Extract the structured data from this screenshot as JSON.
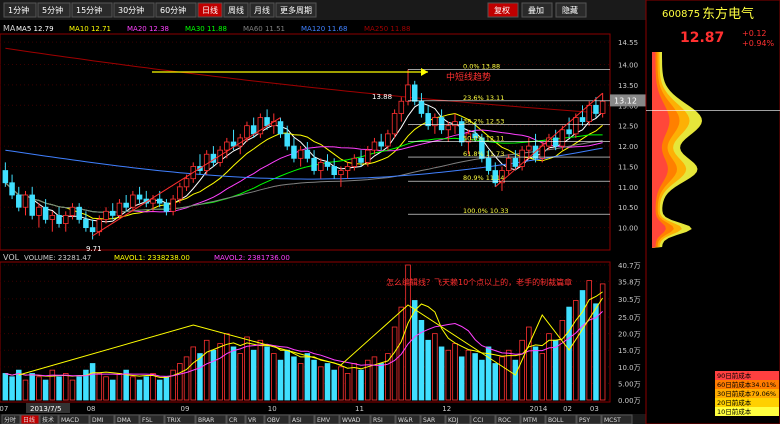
{
  "toolbar": {
    "periods": [
      "1分钟",
      "5分钟",
      "15分钟",
      "30分钟",
      "60分钟",
      "日线",
      "周线",
      "月线",
      "更多周期"
    ],
    "active_period": "日线",
    "right_buttons": [
      "复权",
      "叠加",
      "隐藏"
    ]
  },
  "stock": {
    "code": "600875",
    "name": "东方电气",
    "price": "12.87",
    "change": "+0.12",
    "change_pct": "+0.94%"
  },
  "indicators": {
    "ma_line_label": "MA",
    "ma_values": [
      "MA5 12.79",
      "MA10 12.71",
      "MA20 12.38",
      "MA30 11.88",
      "MA60 11.51",
      "MA120 11.68",
      "MA250 11.88"
    ],
    "vol_label": "VOL",
    "vol_values": [
      "VOLUME: 23281.47",
      "MAVOL1: 2338238.00",
      "MAVOL2: 2381736.00"
    ]
  },
  "annotations": {
    "trend_label": "中短线趋势",
    "volume_note": "怎么编辑线？飞天赖10个点以上的，老手的制裁篇章",
    "high_label": "13.88",
    "low_label": "9.71",
    "price_tag": "13.12",
    "fib_levels": [
      "0.0% 13.88",
      "23.6% 13.11",
      "38.2% 12.53",
      "50.0% 12.11",
      "61.8% 11.73",
      "80.9% 11.14",
      "100.0% 10.33"
    ],
    "date_tag": "2013/7/5"
  },
  "axis": {
    "price_ticks": [
      "14.55",
      "14.00",
      "13.50",
      "13.00",
      "12.50",
      "12.00",
      "11.50",
      "11.00",
      "10.50",
      "10.00"
    ],
    "volume_ticks": [
      "40.7万",
      "35.8万",
      "30.5万",
      "25.0万",
      "20.0万",
      "15.0万",
      "10.0万",
      "5.00万",
      "0.00万"
    ],
    "month_labels": [
      "07",
      "08",
      "09",
      "10",
      "11",
      "12",
      "2014",
      "02",
      "03"
    ]
  },
  "cost_panel": {
    "legend": [
      "90日前成本",
      "60日前成本34.01%",
      "30日前成本79.06%",
      "20日前成本",
      "10日前成本"
    ],
    "legend_colors": [
      "#ff4040",
      "#ff7b00",
      "#ffaa00",
      "#ffd000",
      "#ffff40"
    ]
  },
  "colors": {
    "up": "#ff3030",
    "down": "#40e0ff",
    "ma5": "#ffffff",
    "ma10": "#ffff00",
    "ma20": "#ff40ff",
    "ma30": "#00ff00",
    "ma60": "#808080",
    "ma120": "#4080ff",
    "ma250": "#a00000"
  },
  "bottom_tabs": [
    "分时",
    "日线",
    "技术",
    "MACD",
    "DMI",
    "DMA",
    "FSL",
    "TRIX",
    "BRAR",
    "CR",
    "VR",
    "OBV",
    "ASI",
    "EMV",
    "WVAD",
    "RSI",
    "W&R",
    "SAR",
    "KDJ",
    "CCI",
    "ROC",
    "MTM",
    "BOLL",
    "PSY",
    "MCST"
  ],
  "chart_data": {
    "type": "candlestick",
    "title": "东方电气 600875",
    "ylim": [
      9.5,
      14.7
    ],
    "volume_ylim": [
      0,
      40.7
    ],
    "candles": [
      [
        11.4,
        11.6,
        11.0,
        11.1
      ],
      [
        11.1,
        11.3,
        10.7,
        10.8
      ],
      [
        10.8,
        11.0,
        10.4,
        10.5
      ],
      [
        10.5,
        10.9,
        10.3,
        10.8
      ],
      [
        10.8,
        11.0,
        10.2,
        10.3
      ],
      [
        10.3,
        10.6,
        10.0,
        10.5
      ],
      [
        10.5,
        10.7,
        10.1,
        10.2
      ],
      [
        10.2,
        10.4,
        9.9,
        10.3
      ],
      [
        10.3,
        10.5,
        10.0,
        10.1
      ],
      [
        10.1,
        10.4,
        9.9,
        10.3
      ],
      [
        10.3,
        10.6,
        10.2,
        10.5
      ],
      [
        10.5,
        10.6,
        10.1,
        10.2
      ],
      [
        10.2,
        10.4,
        9.9,
        10.0
      ],
      [
        10.0,
        10.2,
        9.71,
        9.9
      ],
      [
        9.9,
        10.3,
        9.8,
        10.2
      ],
      [
        10.2,
        10.5,
        10.1,
        10.4
      ],
      [
        10.4,
        10.6,
        10.2,
        10.3
      ],
      [
        10.3,
        10.7,
        10.2,
        10.6
      ],
      [
        10.6,
        10.8,
        10.4,
        10.5
      ],
      [
        10.5,
        10.9,
        10.4,
        10.8
      ],
      [
        10.8,
        11.0,
        10.6,
        10.7
      ],
      [
        10.7,
        10.9,
        10.5,
        10.6
      ],
      [
        10.6,
        10.8,
        10.4,
        10.7
      ],
      [
        10.7,
        10.9,
        10.5,
        10.6
      ],
      [
        10.6,
        10.7,
        10.3,
        10.4
      ],
      [
        10.4,
        10.8,
        10.3,
        10.7
      ],
      [
        10.7,
        11.1,
        10.6,
        11.0
      ],
      [
        11.0,
        11.3,
        10.9,
        11.2
      ],
      [
        11.2,
        11.6,
        11.1,
        11.5
      ],
      [
        11.5,
        11.8,
        11.3,
        11.4
      ],
      [
        11.4,
        11.9,
        11.3,
        11.8
      ],
      [
        11.8,
        12.0,
        11.5,
        11.6
      ],
      [
        11.6,
        12.0,
        11.5,
        11.9
      ],
      [
        11.9,
        12.2,
        11.7,
        12.1
      ],
      [
        12.1,
        12.4,
        11.9,
        12.0
      ],
      [
        12.0,
        12.3,
        11.8,
        12.2
      ],
      [
        12.2,
        12.6,
        12.1,
        12.5
      ],
      [
        12.5,
        12.7,
        12.2,
        12.3
      ],
      [
        12.3,
        12.8,
        12.2,
        12.7
      ],
      [
        12.7,
        12.9,
        12.4,
        12.5
      ],
      [
        12.5,
        12.8,
        12.3,
        12.6
      ],
      [
        12.6,
        12.7,
        12.2,
        12.3
      ],
      [
        12.3,
        12.5,
        11.9,
        12.0
      ],
      [
        12.0,
        12.2,
        11.6,
        11.7
      ],
      [
        11.7,
        12.0,
        11.5,
        11.9
      ],
      [
        11.9,
        12.1,
        11.6,
        11.7
      ],
      [
        11.7,
        11.9,
        11.3,
        11.4
      ],
      [
        11.4,
        11.7,
        11.2,
        11.6
      ],
      [
        11.6,
        11.8,
        11.4,
        11.5
      ],
      [
        11.5,
        11.7,
        11.2,
        11.3
      ],
      [
        11.3,
        11.5,
        11.0,
        11.4
      ],
      [
        11.4,
        11.6,
        11.2,
        11.5
      ],
      [
        11.5,
        11.8,
        11.4,
        11.7
      ],
      [
        11.7,
        11.9,
        11.5,
        11.6
      ],
      [
        11.6,
        12.0,
        11.5,
        11.9
      ],
      [
        11.9,
        12.2,
        11.8,
        12.1
      ],
      [
        12.1,
        12.3,
        11.9,
        12.0
      ],
      [
        12.0,
        12.4,
        11.9,
        12.3
      ],
      [
        12.3,
        12.9,
        12.2,
        12.8
      ],
      [
        12.8,
        13.2,
        12.6,
        13.1
      ],
      [
        13.1,
        13.88,
        13.0,
        13.5
      ],
      [
        13.5,
        13.6,
        13.0,
        13.1
      ],
      [
        13.1,
        13.3,
        12.7,
        12.8
      ],
      [
        12.8,
        13.0,
        12.4,
        12.5
      ],
      [
        12.5,
        12.8,
        12.3,
        12.7
      ],
      [
        12.7,
        12.9,
        12.3,
        12.4
      ],
      [
        12.4,
        12.6,
        12.1,
        12.5
      ],
      [
        12.5,
        12.8,
        12.3,
        12.6
      ],
      [
        12.6,
        12.7,
        12.0,
        12.1
      ],
      [
        12.1,
        12.4,
        11.8,
        12.3
      ],
      [
        12.3,
        12.6,
        12.1,
        12.2
      ],
      [
        12.2,
        12.3,
        11.6,
        11.7
      ],
      [
        11.7,
        11.9,
        11.3,
        11.4
      ],
      [
        11.4,
        11.6,
        11.0,
        11.1
      ],
      [
        11.1,
        11.5,
        10.9,
        11.4
      ],
      [
        11.4,
        11.8,
        11.3,
        11.7
      ],
      [
        11.7,
        11.9,
        11.4,
        11.5
      ],
      [
        11.5,
        12.0,
        11.4,
        11.9
      ],
      [
        11.9,
        12.2,
        11.7,
        12.0
      ],
      [
        12.0,
        12.3,
        11.6,
        11.7
      ],
      [
        11.7,
        12.1,
        11.6,
        12.0
      ],
      [
        12.0,
        12.3,
        11.9,
        12.2
      ],
      [
        12.2,
        12.4,
        11.9,
        12.0
      ],
      [
        12.0,
        12.5,
        11.9,
        12.4
      ],
      [
        12.4,
        12.7,
        12.2,
        12.3
      ],
      [
        12.3,
        12.8,
        12.2,
        12.7
      ],
      [
        12.7,
        13.0,
        12.5,
        12.6
      ],
      [
        12.6,
        13.1,
        12.5,
        13.0
      ],
      [
        13.0,
        13.2,
        12.7,
        12.8
      ],
      [
        12.8,
        13.3,
        12.7,
        13.1
      ]
    ],
    "volumes": [
      8,
      7,
      9,
      6,
      8,
      7,
      6,
      9,
      7,
      8,
      6,
      7,
      9,
      11,
      8,
      7,
      6,
      8,
      9,
      7,
      6,
      7,
      8,
      6,
      7,
      9,
      11,
      13,
      16,
      14,
      18,
      15,
      17,
      20,
      16,
      14,
      19,
      15,
      18,
      16,
      14,
      12,
      15,
      13,
      11,
      14,
      12,
      10,
      11,
      9,
      10,
      8,
      11,
      9,
      12,
      13,
      11,
      14,
      22,
      28,
      40.7,
      30,
      24,
      18,
      20,
      16,
      15,
      17,
      13,
      15,
      14,
      12,
      16,
      11,
      13,
      15,
      12,
      18,
      22,
      16,
      14,
      20,
      18,
      24,
      28,
      30,
      33,
      36,
      29,
      35
    ]
  }
}
